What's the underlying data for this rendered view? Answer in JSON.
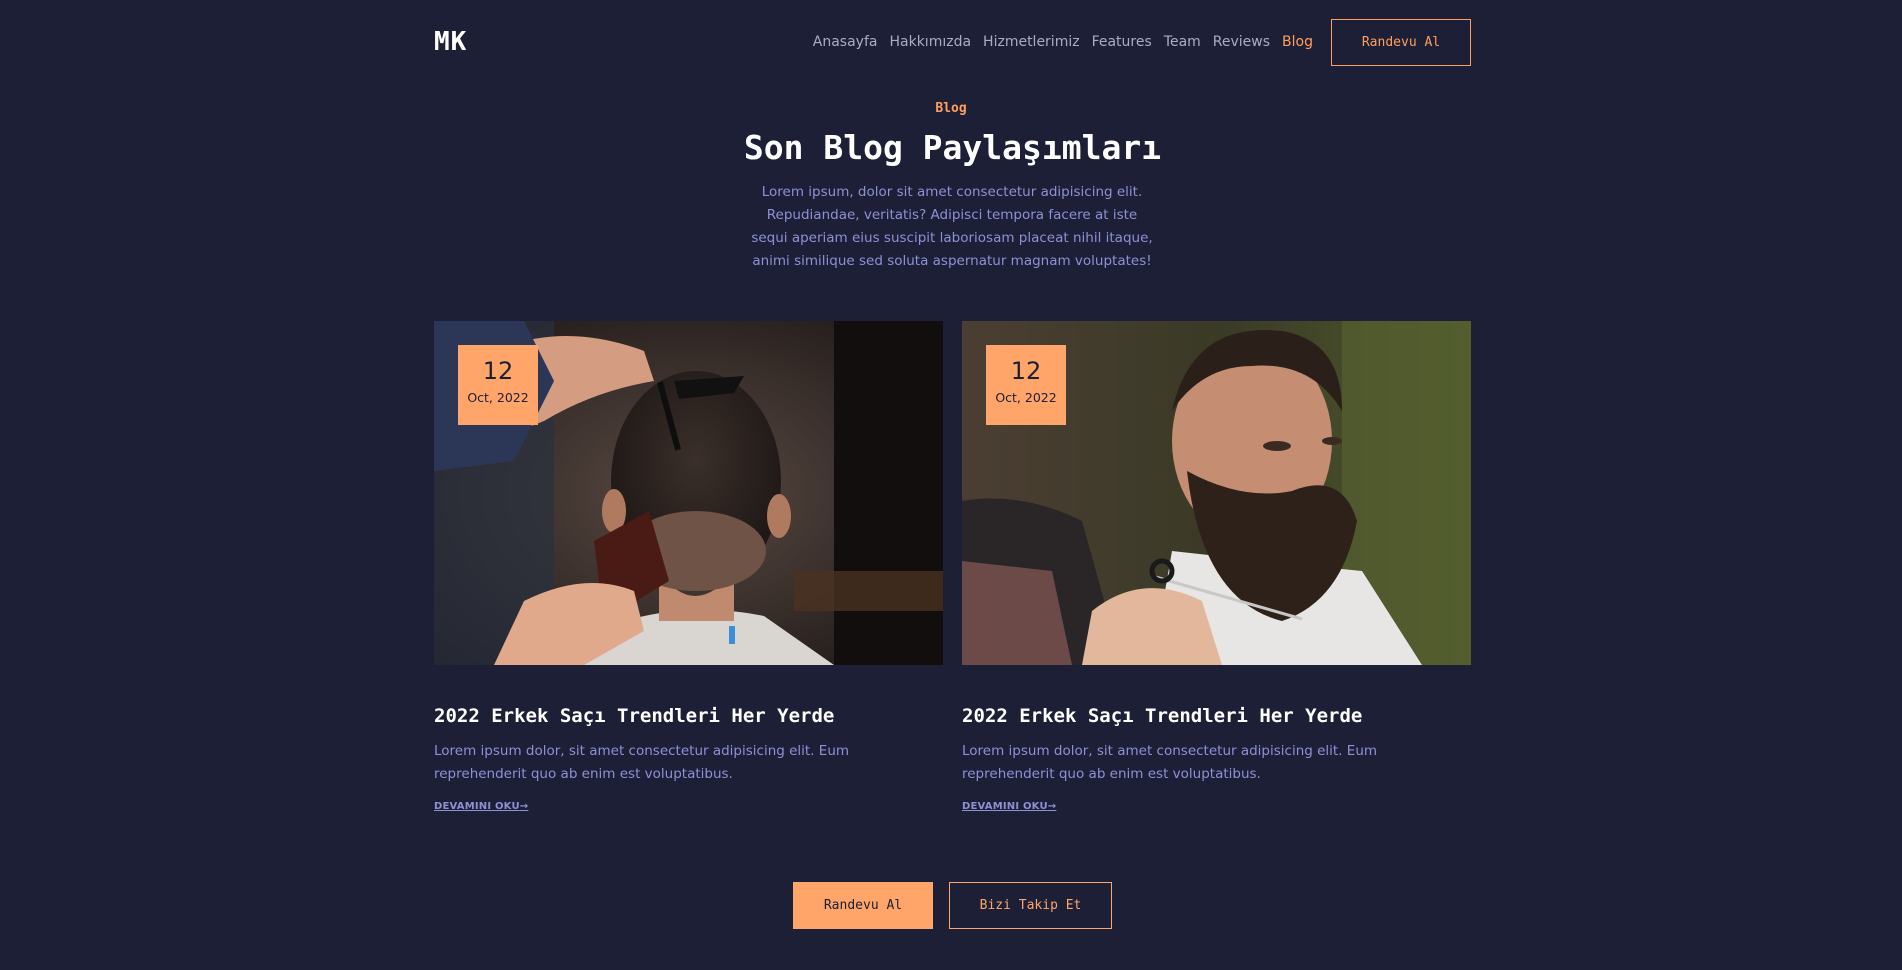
{
  "header": {
    "logo": "MK",
    "nav": [
      {
        "label": "Anasayfa"
      },
      {
        "label": "Hakkımızda"
      },
      {
        "label": "Hizmetlerimiz"
      },
      {
        "label": "Features"
      },
      {
        "label": "Team"
      },
      {
        "label": "Reviews"
      },
      {
        "label": "Blog",
        "active": true
      }
    ],
    "cta": "Randevu Al"
  },
  "section": {
    "eyebrow": "Blog",
    "title": "Son Blog Paylaşımları",
    "lead": "Lorem ipsum, dolor sit amet consectetur adipisicing elit. Repudiandae, veritatis? Adipisci tempora facere at iste sequi aperiam eius suscipit laboriosam placeat nihil itaque, animi similique sed soluta aspernatur magnam voluptates!"
  },
  "posts": [
    {
      "day": "12",
      "month_year": "Oct, 2022",
      "title": "2022 Erkek Saçı Trendleri Her Yerde",
      "excerpt": "Lorem ipsum dolor, sit amet consectetur adipisicing elit. Eum reprehenderit quo ab enim est voluptatibus.",
      "read_more": "DEVAMINI OKU"
    },
    {
      "day": "12",
      "month_year": "Oct, 2022",
      "title": "2022 Erkek Saçı Trendleri Her Yerde",
      "excerpt": "Lorem ipsum dolor, sit amet consectetur adipisicing elit. Eum reprehenderit quo ab enim est voluptatibus.",
      "read_more": "DEVAMINI OKU"
    }
  ],
  "footer_buttons": {
    "primary": "Randevu Al",
    "secondary": "Bizi Takip Et"
  },
  "colors": {
    "background": "#1c1f35",
    "accent": "#ffa56a",
    "muted_text": "#8e91d6",
    "nav_text": "#a9acc6"
  },
  "icons": {
    "read_more": "arrow-right-icon"
  }
}
